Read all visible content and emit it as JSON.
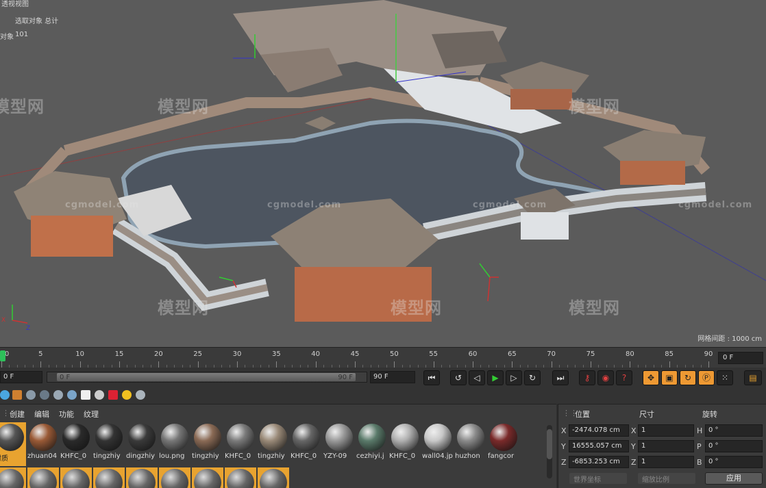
{
  "viewport": {
    "title": "透视视图",
    "stats_labels": "选取对象  总计",
    "object_label": "对象",
    "object_count": "101",
    "grid_spacing": "网格间距 : 1000 cm",
    "watermark_cn": "模型网",
    "watermark_en": "cgmodel.com"
  },
  "timeline": {
    "ticks": [
      "0",
      "5",
      "10",
      "15",
      "20",
      "25",
      "30",
      "35",
      "40",
      "45",
      "50",
      "55",
      "60",
      "65",
      "70",
      "75",
      "80",
      "85",
      "90"
    ],
    "current_frame": "0 F"
  },
  "transport": {
    "start_field": "0 F",
    "range_start": "0 F",
    "range_end": "90 F",
    "end_field": "90 F",
    "buttons": [
      "go-start",
      "prev-key",
      "play-back",
      "play",
      "next-key",
      "loop",
      "go-end"
    ]
  },
  "material_menu": {
    "create": "创建",
    "edit": "编辑",
    "function": "功能",
    "texture": "纹理"
  },
  "materials": [
    {
      "label": "材质",
      "color": "#555555"
    },
    {
      "label": "zhuan04",
      "color": "#9a5a36"
    },
    {
      "label": "KHFC_0",
      "color": "#2a2a2a"
    },
    {
      "label": "tingzhiy",
      "color": "#333333"
    },
    {
      "label": "dingzhiy",
      "color": "#3a3a3a"
    },
    {
      "label": "lou.png",
      "color": "#777777"
    },
    {
      "label": "tingzhiy",
      "color": "#8a6a55"
    },
    {
      "label": "KHFC_0",
      "color": "#7a7a7a"
    },
    {
      "label": "tingzhiy",
      "color": "#9a8a78"
    },
    {
      "label": "KHFC_0",
      "color": "#666666"
    },
    {
      "label": "YZY-09",
      "color": "#9a9a9a"
    },
    {
      "label": "cezhiyi.j",
      "color": "#5a7a6a"
    },
    {
      "label": "KHFC_0",
      "color": "#b0b0b0"
    },
    {
      "label": "wall04.jp",
      "color": "#c8c8c8"
    },
    {
      "label": "huzhon",
      "color": "#8a8a8a"
    },
    {
      "label": "fangcor",
      "color": "#7a2a2a"
    }
  ],
  "attributes": {
    "position_label": "位置",
    "size_label": "尺寸",
    "rotation_label": "旋转",
    "x_label": "X",
    "y_label": "Y",
    "z_label": "Z",
    "h_label": "H",
    "p_label": "P",
    "b_label": "B",
    "pos_x": "-2474.078 cm",
    "pos_y": "16555.057 cm",
    "pos_z": "-6853.253 cm",
    "size_x": "1",
    "size_y": "1",
    "size_z": "1",
    "rot_h": "0 °",
    "rot_p": "0 °",
    "rot_b": "0 °",
    "coord_dropdown": "世界坐标",
    "scale_dropdown": "缩放比例",
    "apply_button": "应用"
  }
}
